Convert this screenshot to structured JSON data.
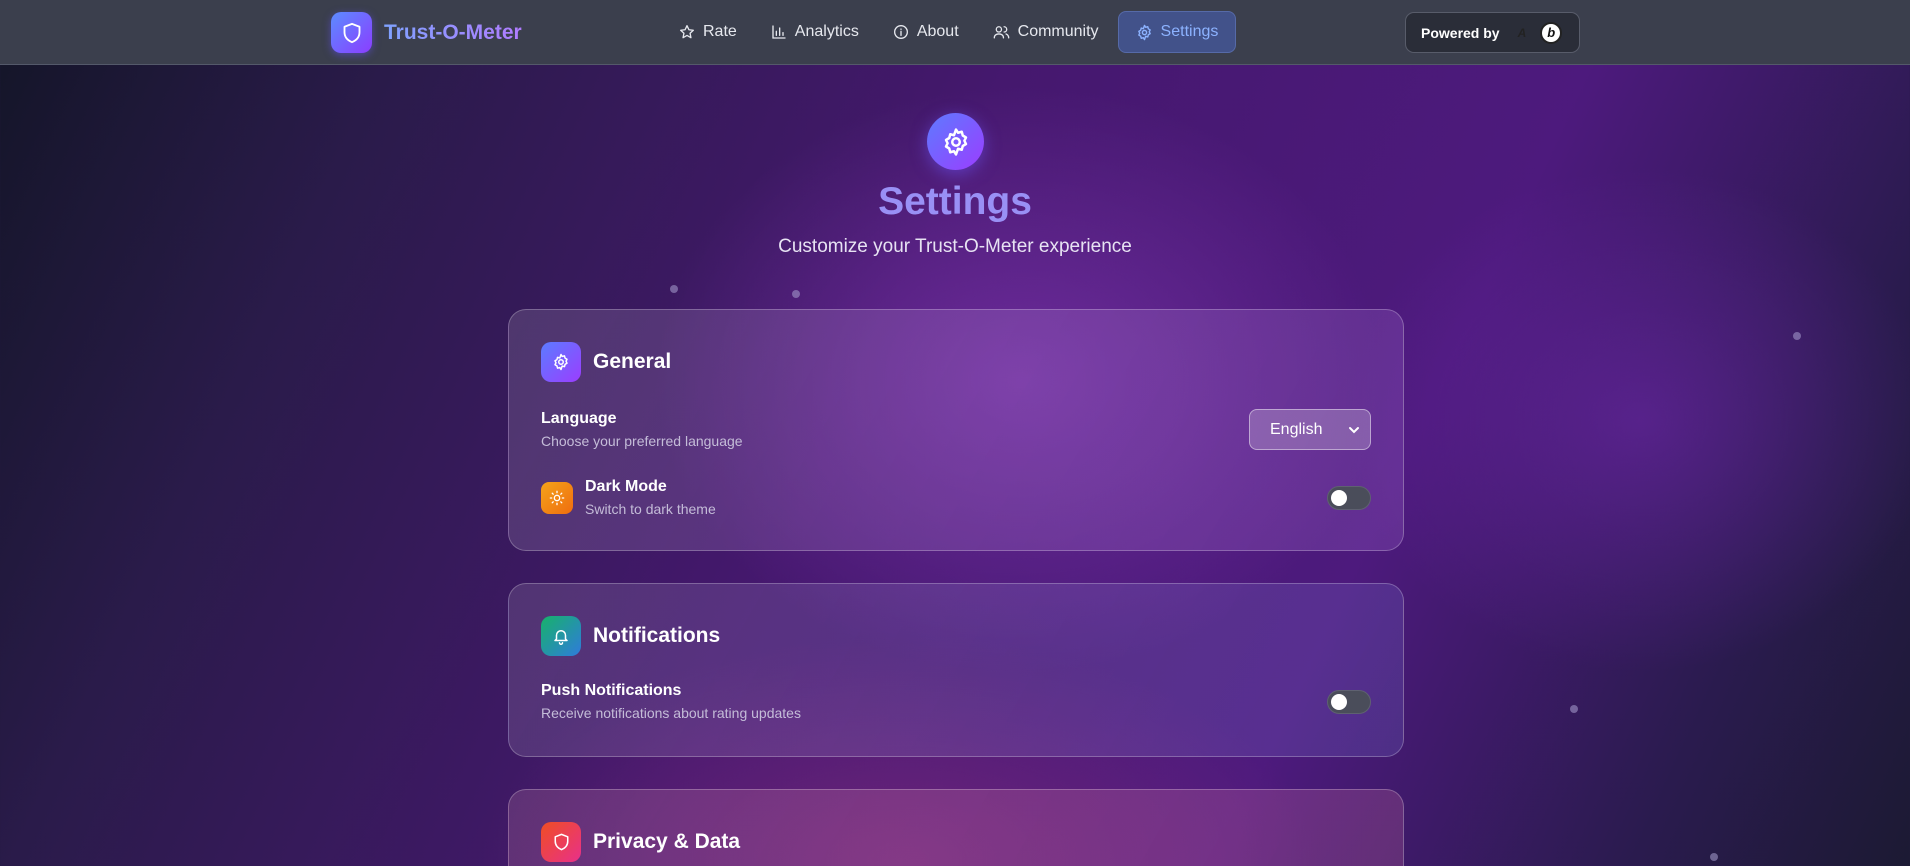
{
  "app": {
    "name": "Trust-O-Meter"
  },
  "nav": {
    "items": [
      {
        "label": "Rate",
        "icon": "star-icon"
      },
      {
        "label": "Analytics",
        "icon": "bar-chart-icon"
      },
      {
        "label": "About",
        "icon": "info-icon"
      },
      {
        "label": "Community",
        "icon": "users-icon"
      },
      {
        "label": "Settings",
        "icon": "gear-icon",
        "active": true
      }
    ]
  },
  "powered": {
    "label": "Powered by",
    "a_mark": "A",
    "b_mark": "b"
  },
  "header": {
    "title": "Settings",
    "subtitle": "Customize your Trust-O-Meter experience"
  },
  "sections": {
    "general": {
      "title": "General",
      "language": {
        "label": "Language",
        "desc": "Choose your preferred language",
        "value": "English"
      },
      "dark_mode": {
        "label": "Dark Mode",
        "desc": "Switch to dark theme",
        "enabled": false
      }
    },
    "notifications": {
      "title": "Notifications",
      "push": {
        "label": "Push Notifications",
        "desc": "Receive notifications about rating updates",
        "enabled": false
      }
    },
    "privacy": {
      "title": "Privacy & Data"
    }
  },
  "colors": {
    "accent": "#8cb2ff",
    "title": "#9990f5",
    "general_icon": "#7a5cff",
    "notifications_icon": "#1ea39a",
    "privacy_icon": "#f04e23",
    "dark_mode_icon": "#f4a31a"
  }
}
